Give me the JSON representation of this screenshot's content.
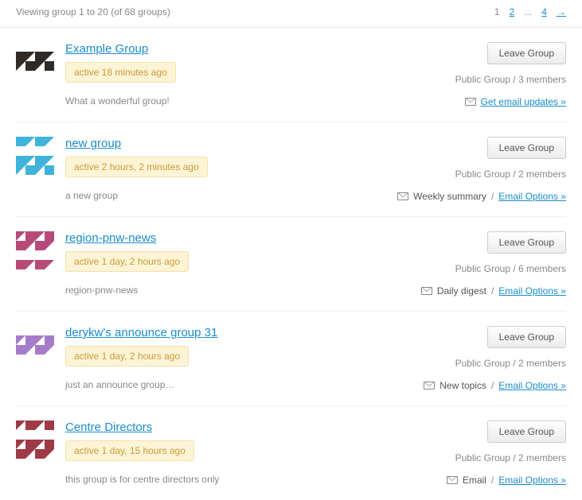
{
  "header": {
    "viewing_text": "Viewing group 1 to 20 (of 68 groups)",
    "pagination": {
      "current": "1",
      "page2": "2",
      "ellipsis": "...",
      "page4": "4",
      "next": "→"
    }
  },
  "leave_label": "Leave Group",
  "groups": [
    {
      "title": "Example Group",
      "activity": "active 18 minutes ago",
      "desc": "What a wonderful group!",
      "meta": "Public Group / 3 members",
      "email_status": "",
      "email_link": "Get email updates »",
      "avatar_color": "#2f2a26"
    },
    {
      "title": "new group",
      "activity": "active 2 hours, 2 minutes ago",
      "desc": "a new group",
      "meta": "Public Group / 2 members",
      "email_status": "Weekly summary",
      "email_link": "Email Options »",
      "avatar_color": "#3fb3d9"
    },
    {
      "title": "region-pnw-news",
      "activity": "active 1 day, 2 hours ago",
      "desc": "region-pnw-news",
      "meta": "Public Group / 6 members",
      "email_status": "Daily digest",
      "email_link": "Email Options »",
      "avatar_color": "#b84a7a"
    },
    {
      "title": "derykw's announce group 31",
      "activity": "active 1 day, 2 hours ago",
      "desc": "just an announce group…",
      "meta": "Public Group / 2 members",
      "email_status": "New topics",
      "email_link": "Email Options »",
      "avatar_color": "#a57cca"
    },
    {
      "title": "Centre Directors",
      "activity": "active 1 day, 15 hours ago",
      "desc": "this group is for centre directors only",
      "meta": "Public Group / 2 members",
      "email_status": "Email",
      "email_link": "Email Options »",
      "avatar_color": "#9e3a46"
    }
  ]
}
